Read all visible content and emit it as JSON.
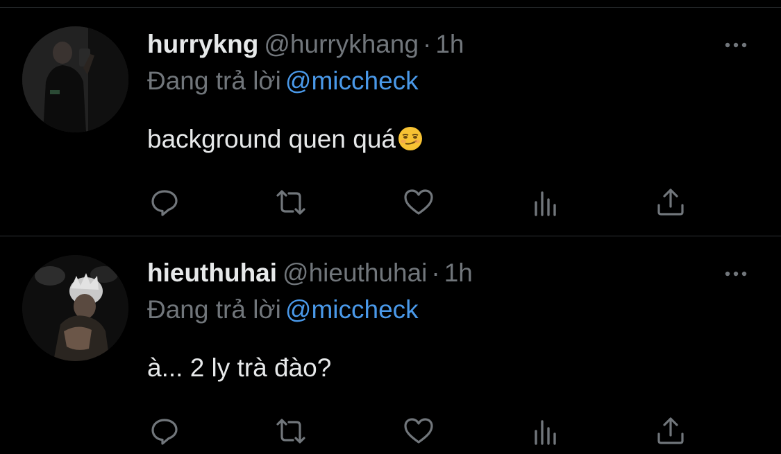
{
  "tweets": [
    {
      "display_name": "hurrykng",
      "handle": "@hurrykhang",
      "separator": "·",
      "time": "1h",
      "reply_prefix": "Đang trả lời",
      "reply_to": "@miccheck",
      "text": "background quen quá",
      "emoji": "smirking-face",
      "avatar_icon": "profile-photo"
    },
    {
      "display_name": "hieuthuhai",
      "handle": "@hieuthuhai",
      "separator": "·",
      "time": "1h",
      "reply_prefix": "Đang trả lời",
      "reply_to": "@miccheck",
      "text": "à... 2 ly trà đào?",
      "avatar_icon": "profile-photo"
    }
  ],
  "actions": [
    "reply-icon",
    "retweet-icon",
    "like-icon",
    "views-icon",
    "share-icon"
  ],
  "colors": {
    "background": "#000000",
    "primary_text": "#e7e9ea",
    "secondary_text": "#71767b",
    "mention": "#4a99e9",
    "divider": "#2f3336"
  }
}
